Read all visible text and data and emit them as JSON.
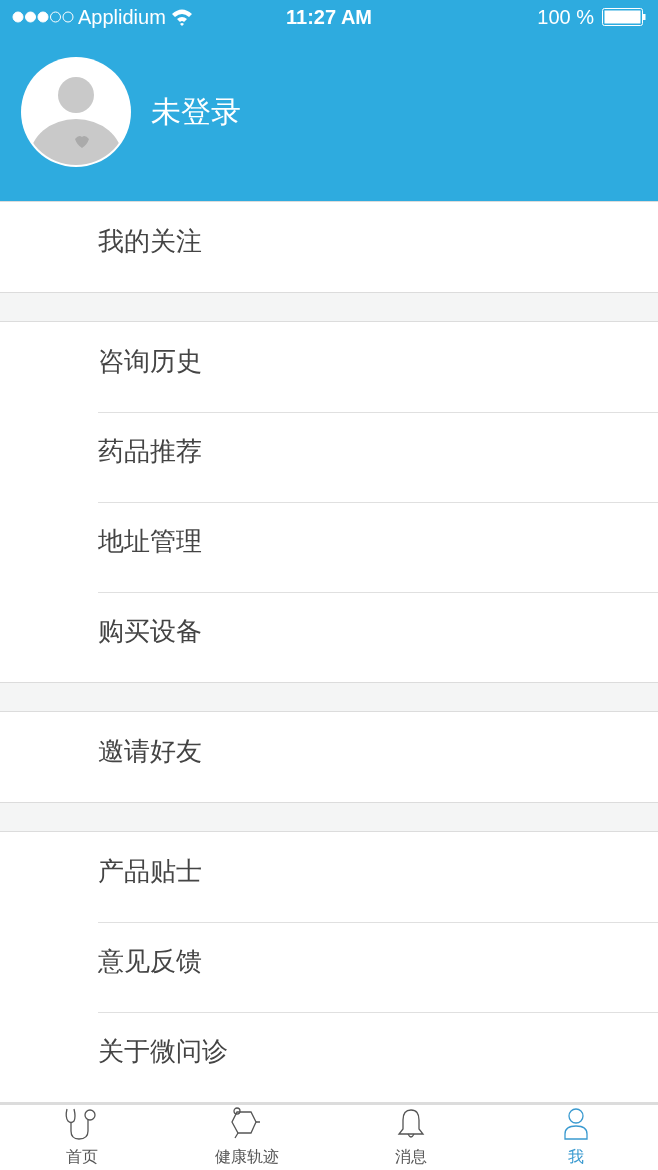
{
  "status_bar": {
    "carrier": "Applidium",
    "time": "11:27 AM",
    "battery": "100 %"
  },
  "profile": {
    "username": "未登录"
  },
  "groups": [
    {
      "items": [
        {
          "label": "我的关注"
        }
      ]
    },
    {
      "items": [
        {
          "label": "咨询历史"
        },
        {
          "label": "药品推荐"
        },
        {
          "label": "地址管理"
        },
        {
          "label": "购买设备"
        }
      ]
    },
    {
      "items": [
        {
          "label": "邀请好友"
        }
      ]
    },
    {
      "items": [
        {
          "label": "产品贴士"
        },
        {
          "label": "意见反馈"
        },
        {
          "label": "关于微问诊"
        }
      ]
    }
  ],
  "tab_bar": [
    {
      "label": "首页",
      "kind": "stethoscope",
      "selected": false
    },
    {
      "label": "健康轨迹",
      "kind": "hexagon",
      "selected": false
    },
    {
      "label": "消息",
      "kind": "bell",
      "selected": false
    },
    {
      "label": "我",
      "kind": "person",
      "selected": true
    }
  ]
}
